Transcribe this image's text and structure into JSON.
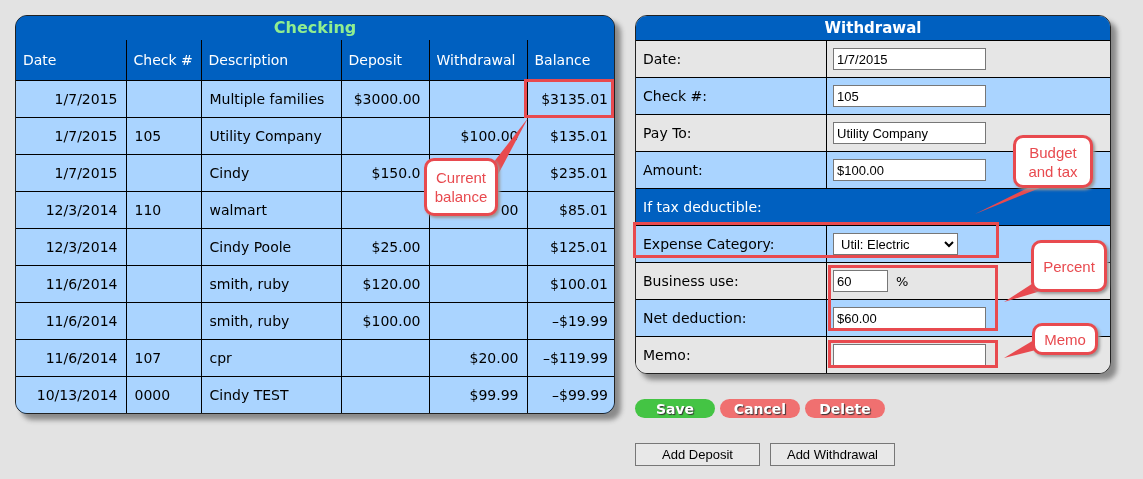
{
  "checking": {
    "title": "Checking",
    "columns": [
      "Date",
      "Check #",
      "Description",
      "Deposit",
      "Withdrawal",
      "Balance"
    ],
    "rows": [
      [
        "1/7/2015",
        "",
        "Multiple families",
        "$3000.00",
        "",
        "$3135.01"
      ],
      [
        "1/7/2015",
        "105",
        "Utility Company",
        "",
        "$100.00",
        "$135.01"
      ],
      [
        "1/7/2015",
        "",
        "Cindy",
        "$150.0",
        "",
        "$235.01"
      ],
      [
        "12/3/2014",
        "110",
        "walmart",
        "",
        "00",
        "$85.01"
      ],
      [
        "12/3/2014",
        "",
        "Cindy Poole",
        "$25.00",
        "",
        "$125.01"
      ],
      [
        "11/6/2014",
        "",
        "smith, ruby",
        "$120.00",
        "",
        "$100.01"
      ],
      [
        "11/6/2014",
        "",
        "smith, ruby",
        "$100.00",
        "",
        "–$19.99"
      ],
      [
        "11/6/2014",
        "107",
        "cpr",
        "",
        "$20.00",
        "–$119.99"
      ],
      [
        "10/13/2014",
        "0000",
        "Cindy TEST",
        "",
        "$99.99",
        "–$99.99"
      ]
    ]
  },
  "withdrawal": {
    "title": "Withdrawal",
    "rows": [
      {
        "kind": "field",
        "label": "Date:",
        "value": "1/7/2015"
      },
      {
        "kind": "field",
        "label": "Check #:",
        "value": "105"
      },
      {
        "kind": "field",
        "label": "Pay To:",
        "value": "Utility Company"
      },
      {
        "kind": "field",
        "label": "Amount:",
        "value": "$100.00"
      },
      {
        "kind": "section",
        "label": "If tax deductible:"
      },
      {
        "kind": "select",
        "label": "Expense Category:",
        "value": "Util: Electric"
      },
      {
        "kind": "percent",
        "label": "Business use:",
        "value": "60",
        "unit": "%"
      },
      {
        "kind": "field",
        "label": "Net deduction:",
        "value": "$60.00"
      },
      {
        "kind": "field",
        "label": "Memo:"
      }
    ]
  },
  "actions": [
    {
      "label": "Save",
      "kind": "save"
    },
    {
      "label": "Cancel",
      "kind": "cancel"
    },
    {
      "label": "Delete",
      "kind": "delete"
    }
  ],
  "add_buttons": [
    "Add Deposit",
    "Add Withdrawal"
  ],
  "annotations": [
    {
      "text": "Current balance"
    },
    {
      "text": "Budget and tax"
    },
    {
      "text": "Percent"
    },
    {
      "text": "Memo"
    }
  ]
}
